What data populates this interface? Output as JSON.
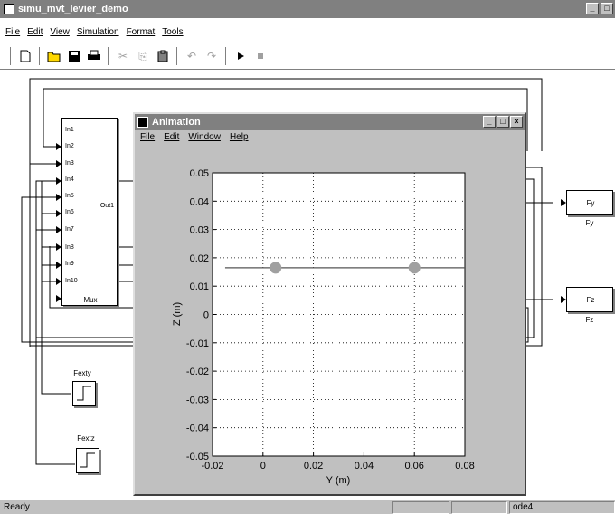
{
  "window": {
    "title": "simu_mvt_levier_demo",
    "min_label": "_",
    "max_label": "□"
  },
  "menubar": {
    "items": [
      "File",
      "Edit",
      "View",
      "Simulation",
      "Format",
      "Tools"
    ]
  },
  "toolbar": {
    "icons": [
      "new-icon",
      "open-icon",
      "save-icon",
      "print-icon",
      "cut-icon",
      "copy-icon",
      "paste-icon",
      "undo-icon",
      "redo-icon",
      "play-icon",
      "stop-icon"
    ]
  },
  "model": {
    "mux": {
      "name": "Mux",
      "inputs": [
        "In1",
        "In2",
        "In3",
        "In4",
        "In5",
        "In6",
        "In7",
        "In8",
        "In9",
        "In10"
      ],
      "output": "Out1"
    },
    "fy_block": {
      "label": "Fy",
      "name": "Fy"
    },
    "fz_block": {
      "label": "Fz",
      "name": "Fz"
    },
    "fexty_block": {
      "name": "Fexty"
    },
    "fextz_block": {
      "name": "Fextz"
    }
  },
  "status": {
    "text": "Ready",
    "solver": "ode4"
  },
  "animation": {
    "title": "Animation",
    "min_label": "_",
    "max_label": "□",
    "close_label": "×",
    "menu": [
      "File",
      "Edit",
      "Window",
      "Help"
    ]
  },
  "chart_data": {
    "type": "line",
    "title": "",
    "xlabel": "Y (m)",
    "ylabel": "Z (m)",
    "xlim": [
      -0.02,
      0.08
    ],
    "ylim": [
      -0.05,
      0.05
    ],
    "xticks": [
      "-0.02",
      "0",
      "0.02",
      "0.04",
      "0.06",
      "0.08"
    ],
    "yticks": [
      "0.05",
      "0.04",
      "0.03",
      "0.02",
      "0.01",
      "0",
      "-0.01",
      "-0.02",
      "-0.03",
      "-0.04",
      "-0.05"
    ],
    "grid": true,
    "lever_line": {
      "x": [
        -0.015,
        0.08
      ],
      "y": [
        0.0165,
        0.0165
      ]
    },
    "points": [
      {
        "x": 0.005,
        "y": 0.0165
      },
      {
        "x": 0.06,
        "y": 0.0165
      }
    ],
    "colors": {
      "line": "#555555",
      "points": "#a0a0a0"
    }
  }
}
